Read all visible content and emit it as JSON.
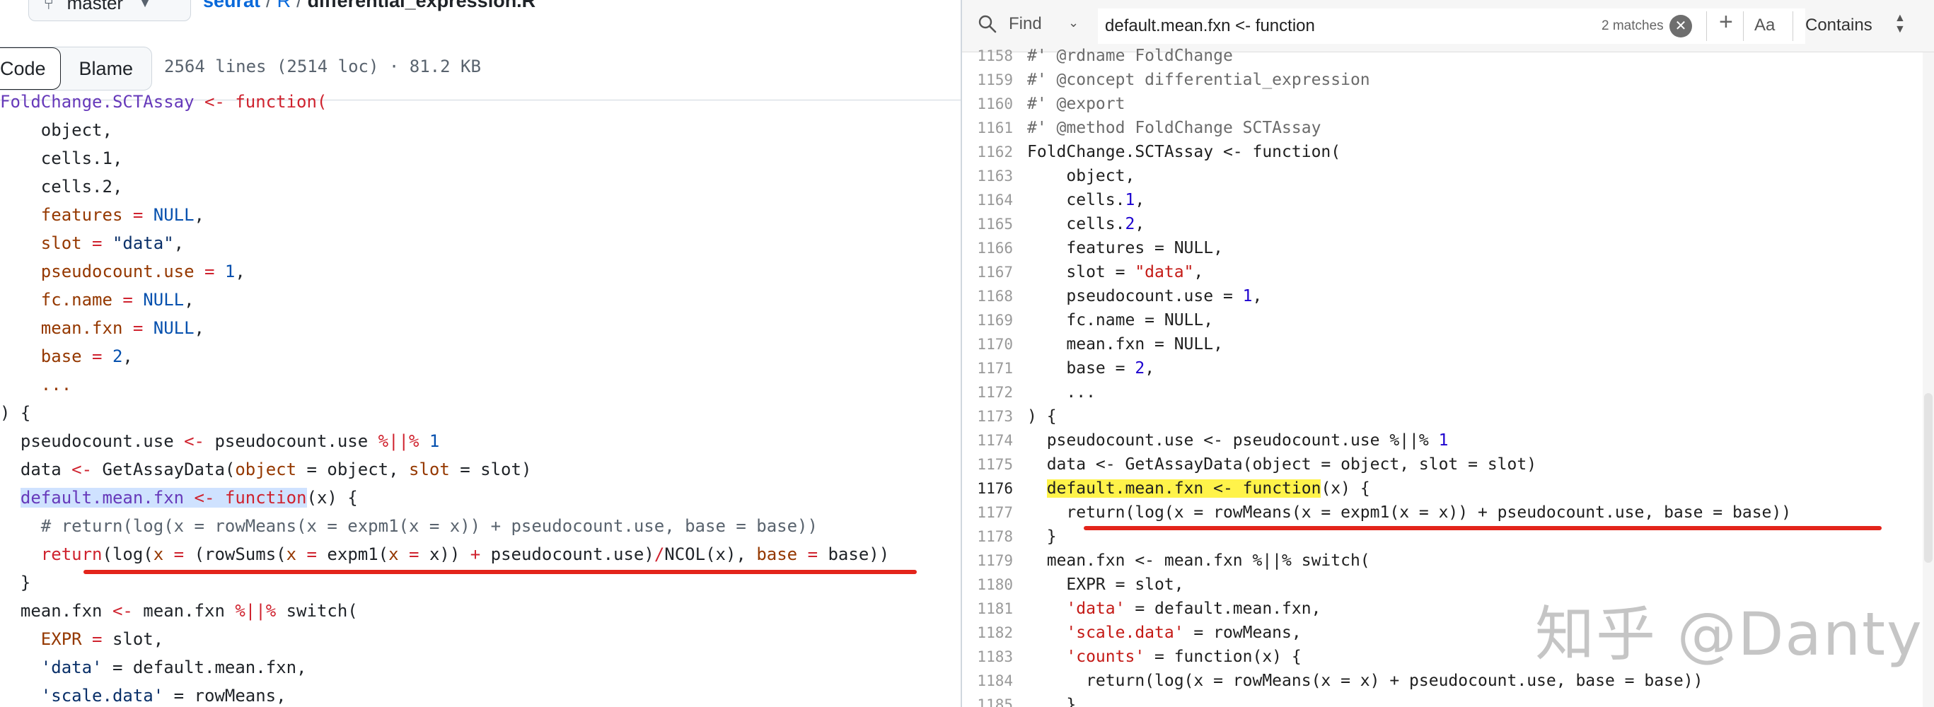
{
  "left": {
    "branch": "master",
    "breadcrumb": {
      "repo": "seurat",
      "dir": "R",
      "file": "differential_expression.R"
    },
    "view_tabs": [
      {
        "label": "Code"
      },
      {
        "label": "Blame"
      }
    ],
    "file_info": "2564 lines (2514 loc) · 81.2 KB",
    "code": [
      [
        {
          "t": "FoldChange.SCTAssay ",
          "c": "f"
        },
        {
          "t": "<-",
          "c": "k"
        },
        {
          "t": " function(",
          "c": "k"
        }
      ],
      [
        {
          "t": "    object,"
        }
      ],
      [
        {
          "t": "    cells.1,"
        }
      ],
      [
        {
          "t": "    cells.2,"
        }
      ],
      [
        {
          "t": "    features ",
          "c": "p"
        },
        {
          "t": "=",
          "c": "k"
        },
        {
          "t": " NULL",
          "c": "n"
        },
        {
          "t": ","
        }
      ],
      [
        {
          "t": "    slot ",
          "c": "p"
        },
        {
          "t": "=",
          "c": "k"
        },
        {
          "t": " \"data\"",
          "c": "s"
        },
        {
          "t": ","
        }
      ],
      [
        {
          "t": "    pseudocount.use ",
          "c": "p"
        },
        {
          "t": "=",
          "c": "k"
        },
        {
          "t": " 1",
          "c": "n"
        },
        {
          "t": ","
        }
      ],
      [
        {
          "t": "    fc.name ",
          "c": "p"
        },
        {
          "t": "=",
          "c": "k"
        },
        {
          "t": " NULL",
          "c": "n"
        },
        {
          "t": ","
        }
      ],
      [
        {
          "t": "    mean.fxn ",
          "c": "p"
        },
        {
          "t": "=",
          "c": "k"
        },
        {
          "t": " NULL",
          "c": "n"
        },
        {
          "t": ","
        }
      ],
      [
        {
          "t": "    base ",
          "c": "p"
        },
        {
          "t": "=",
          "c": "k"
        },
        {
          "t": " 2",
          "c": "n"
        },
        {
          "t": ","
        }
      ],
      [
        {
          "t": "    ...",
          "c": "p"
        }
      ],
      [
        {
          "t": ") {"
        }
      ],
      [
        {
          "t": "  pseudocount.use "
        },
        {
          "t": "<-",
          "c": "k"
        },
        {
          "t": " pseudocount.use "
        },
        {
          "t": "%||%",
          "c": "k"
        },
        {
          "t": " 1",
          "c": "n"
        }
      ],
      [
        {
          "t": "  data "
        },
        {
          "t": "<-",
          "c": "k"
        },
        {
          "t": " GetAssayData("
        },
        {
          "t": "object",
          "c": "p"
        },
        {
          "t": " = object, "
        },
        {
          "t": "slot",
          "c": "p"
        },
        {
          "t": " = slot)"
        }
      ],
      [
        {
          "t": "  "
        },
        {
          "t": "default.mean.fxn ",
          "c": "f",
          "hl": "sel"
        },
        {
          "t": "<-",
          "c": "k",
          "hl": "sel"
        },
        {
          "t": " function",
          "c": "k",
          "hl": "sel"
        },
        {
          "t": "(x) {"
        }
      ],
      [
        {
          "t": "    # return(log(x = rowMeans(x = expm1(x = x)) + pseudocount.use, base = base))",
          "c": "c"
        }
      ],
      [
        {
          "t": "    "
        },
        {
          "t": "return",
          "c": "k"
        },
        {
          "t": "(log("
        },
        {
          "t": "x",
          "c": "p"
        },
        {
          "t": " = ",
          "c": "k"
        },
        {
          "t": "(rowSums("
        },
        {
          "t": "x",
          "c": "p"
        },
        {
          "t": " = ",
          "c": "k"
        },
        {
          "t": "expm1("
        },
        {
          "t": "x",
          "c": "p"
        },
        {
          "t": " = ",
          "c": "k"
        },
        {
          "t": "x)) "
        },
        {
          "t": "+",
          "c": "k"
        },
        {
          "t": " pseudocount.use)"
        },
        {
          "t": "/",
          "c": "k"
        },
        {
          "t": "NCOL(x), "
        },
        {
          "t": "base",
          "c": "p"
        },
        {
          "t": " = ",
          "c": "k"
        },
        {
          "t": "base))"
        }
      ],
      [
        {
          "t": "  }"
        }
      ],
      [
        {
          "t": "  mean.fxn "
        },
        {
          "t": "<-",
          "c": "k"
        },
        {
          "t": " mean.fxn "
        },
        {
          "t": "%||%",
          "c": "k"
        },
        {
          "t": " switch("
        }
      ],
      [
        {
          "t": "    EXPR ",
          "c": "p"
        },
        {
          "t": "=",
          "c": "k"
        },
        {
          "t": " slot,"
        }
      ],
      [
        {
          "t": "    'data'",
          "c": "s"
        },
        {
          "t": " = default.mean.fxn,"
        }
      ],
      [
        {
          "t": "    'scale.data'",
          "c": "s"
        },
        {
          "t": " = rowMeans,"
        }
      ]
    ]
  },
  "find": {
    "mode": "Find",
    "query": "default.mean.fxn <- function",
    "matches": "2 matches",
    "case_label": "Aa",
    "match_mode": "Contains"
  },
  "right": {
    "lines": [
      {
        "no": "1158",
        "tok": [
          {
            "t": "#' @rdname FoldChange",
            "c": "rc"
          }
        ]
      },
      {
        "no": "1159",
        "tok": [
          {
            "t": "#' @concept differential_expression",
            "c": "rc"
          }
        ]
      },
      {
        "no": "1160",
        "tok": [
          {
            "t": "#' @export",
            "c": "rc"
          }
        ]
      },
      {
        "no": "1161",
        "tok": [
          {
            "t": "#' @method FoldChange SCTAssay",
            "c": "rc"
          }
        ]
      },
      {
        "no": "1162",
        "tok": [
          {
            "t": "FoldChange.SCTAssay <- function("
          }
        ]
      },
      {
        "no": "1163",
        "tok": [
          {
            "t": "    object,"
          }
        ]
      },
      {
        "no": "1164",
        "tok": [
          {
            "t": "    cells."
          },
          {
            "t": "1",
            "c": "rn"
          },
          {
            "t": ","
          }
        ]
      },
      {
        "no": "1165",
        "tok": [
          {
            "t": "    cells."
          },
          {
            "t": "2",
            "c": "rn"
          },
          {
            "t": ","
          }
        ]
      },
      {
        "no": "1166",
        "tok": [
          {
            "t": "    features = NULL,"
          }
        ]
      },
      {
        "no": "1167",
        "tok": [
          {
            "t": "    slot = "
          },
          {
            "t": "\"data\"",
            "c": "rs"
          },
          {
            "t": ","
          }
        ]
      },
      {
        "no": "1168",
        "tok": [
          {
            "t": "    pseudocount.use = "
          },
          {
            "t": "1",
            "c": "rn"
          },
          {
            "t": ","
          }
        ]
      },
      {
        "no": "1169",
        "tok": [
          {
            "t": "    fc.name = NULL,"
          }
        ]
      },
      {
        "no": "1170",
        "tok": [
          {
            "t": "    mean.fxn = NULL,"
          }
        ]
      },
      {
        "no": "1171",
        "tok": [
          {
            "t": "    base = "
          },
          {
            "t": "2",
            "c": "rn"
          },
          {
            "t": ","
          }
        ]
      },
      {
        "no": "1172",
        "tok": [
          {
            "t": "    ..."
          }
        ]
      },
      {
        "no": "1173",
        "tok": [
          {
            "t": ") {"
          }
        ]
      },
      {
        "no": "1174",
        "tok": [
          {
            "t": "  pseudocount.use <- pseudocount.use %||% "
          },
          {
            "t": "1",
            "c": "rn"
          }
        ]
      },
      {
        "no": "1175",
        "tok": [
          {
            "t": "  data <- GetAssayData(object = object, slot = slot)"
          }
        ]
      },
      {
        "no": "1176",
        "current": true,
        "tok": [
          {
            "t": "  "
          },
          {
            "t": "default.mean.fxn <- function",
            "hl": "find"
          },
          {
            "t": "(x) {"
          }
        ]
      },
      {
        "no": "1177",
        "tok": [
          {
            "t": "    return(log(x = rowMeans(x = expm1(x = x)) + pseudocount.use, base = base))"
          }
        ]
      },
      {
        "no": "1178",
        "tok": [
          {
            "t": "  }"
          }
        ]
      },
      {
        "no": "1179",
        "tok": [
          {
            "t": "  mean.fxn <- mean.fxn %||% switch("
          }
        ]
      },
      {
        "no": "1180",
        "tok": [
          {
            "t": "    EXPR = slot,"
          }
        ]
      },
      {
        "no": "1181",
        "tok": [
          {
            "t": "    "
          },
          {
            "t": "'data'",
            "c": "rs"
          },
          {
            "t": " = default.mean.fxn,"
          }
        ]
      },
      {
        "no": "1182",
        "tok": [
          {
            "t": "    "
          },
          {
            "t": "'scale.data'",
            "c": "rs"
          },
          {
            "t": " = rowMeans,"
          }
        ]
      },
      {
        "no": "1183",
        "tok": [
          {
            "t": "    "
          },
          {
            "t": "'counts'",
            "c": "rs"
          },
          {
            "t": " = function(x) {"
          }
        ]
      },
      {
        "no": "1184",
        "tok": [
          {
            "t": "      return(log(x = rowMeans(x = x) + pseudocount.use, base = base))"
          }
        ]
      },
      {
        "no": "1185",
        "tok": [
          {
            "t": "    }"
          }
        ]
      }
    ]
  },
  "watermark": "知乎 @Danty",
  "colors": {
    "annotation_red": "#e3241b",
    "find_highlight": "#fff34a",
    "selection": "#cfe2ff"
  }
}
